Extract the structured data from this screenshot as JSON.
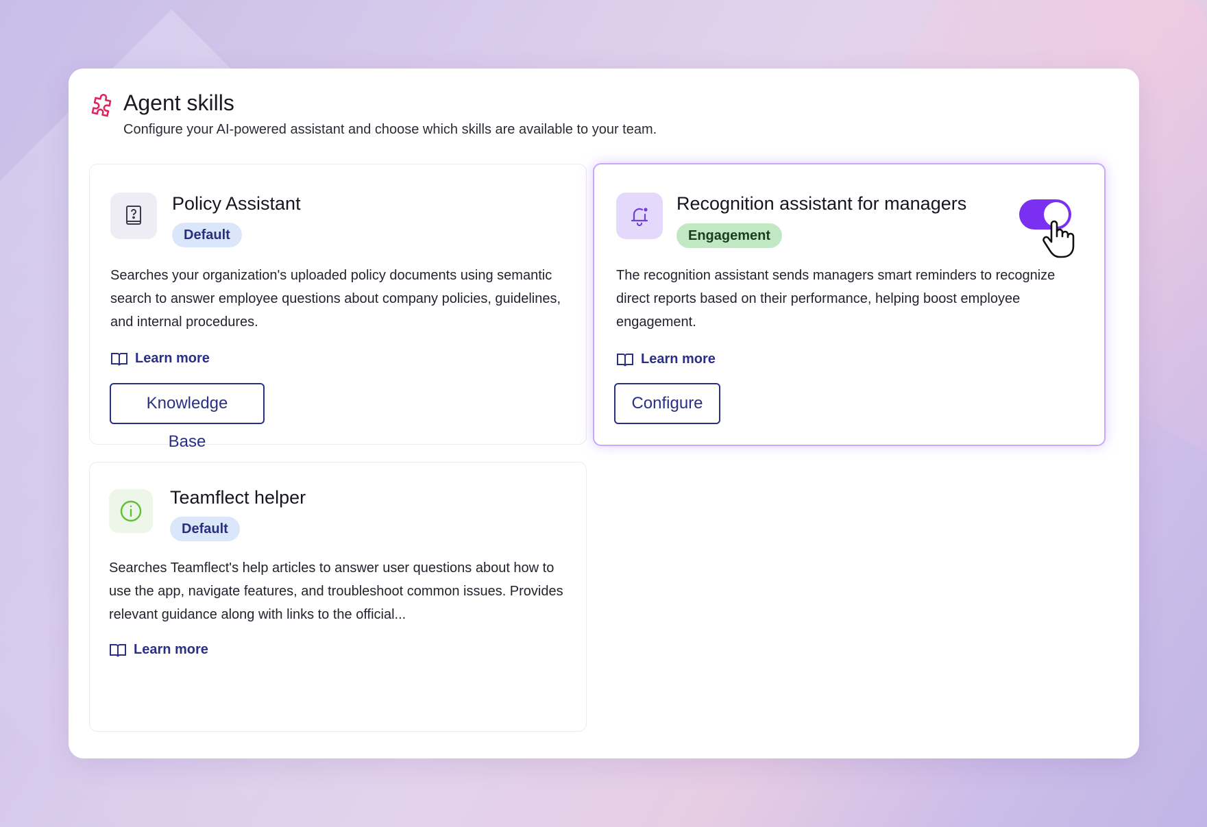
{
  "header": {
    "title": "Agent skills",
    "subtitle": "Configure your AI-powered assistant and choose which skills are available to your team."
  },
  "cards": [
    {
      "title": "Policy Assistant",
      "badge": "Default",
      "description": "Searches your organization's uploaded policy documents using semantic search to answer employee questions about company policies, guidelines, and internal procedures.",
      "learn_more": "Learn more",
      "button": "Knowledge Base",
      "icon": "policy-document-icon"
    },
    {
      "title": "Recognition assistant for managers",
      "badge": "Engagement",
      "description": "The recognition assistant sends managers smart reminders to recognize direct reports based on their performance, helping boost employee engagement.",
      "learn_more": "Learn more",
      "button": "Configure",
      "icon": "bell-icon",
      "enabled": true
    },
    {
      "title": "Teamflect helper",
      "badge": "Default",
      "description": "Searches Teamflect's help articles to answer user questions about how to use the app, navigate features, and troubleshoot common issues. Provides relevant guidance along with links to the official...",
      "learn_more": "Learn more",
      "icon": "info-icon"
    }
  ],
  "colors": {
    "accent": "#7b2ff0",
    "link": "#2a2f86",
    "badge_default_bg": "#dce6fb",
    "badge_engagement_bg": "#bfe8c3",
    "header_icon": "#e0245e"
  }
}
